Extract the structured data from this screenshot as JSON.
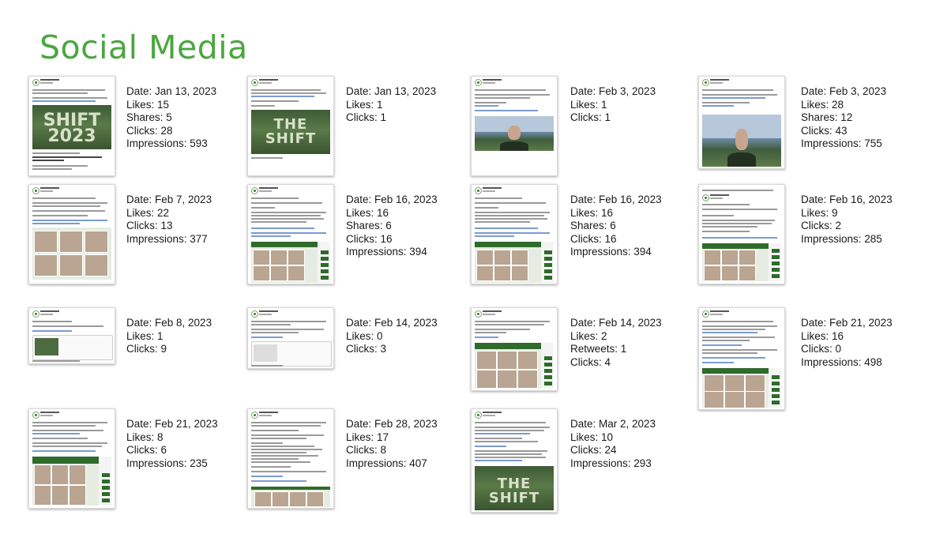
{
  "title": "Social Media",
  "posts": [
    {
      "date": "Date: Jan 13, 2023",
      "lines": [
        "Likes: 15",
        "Shares: 5",
        "Clicks: 28",
        "Impressions: 593"
      ],
      "media_text": "SHIFT 2023"
    },
    {
      "date": "Date: Jan 13, 2023",
      "lines": [
        "Likes: 1",
        "Clicks: 1"
      ],
      "media_text": "THE SHIFT"
    },
    {
      "date": "Date: Feb 3, 2023",
      "lines": [
        "Likes: 1",
        "Clicks: 1"
      ]
    },
    {
      "date": "Date: Feb 3, 2023",
      "lines": [
        "Likes: 28",
        "Shares: 12",
        "Clicks: 43",
        "Impressions: 755"
      ]
    },
    {
      "date": "Date: Feb 7, 2023",
      "lines": [
        "Likes: 22",
        "Clicks: 13",
        "Impressions: 377"
      ]
    },
    {
      "date": "Date: Feb 16, 2023",
      "lines": [
        "Likes: 16",
        "Shares: 6",
        "Clicks: 16",
        "Impressions: 394"
      ]
    },
    {
      "date": "Date: Feb 16, 2023",
      "lines": [
        "Likes: 16",
        "Shares: 6",
        "Clicks: 16",
        "Impressions: 394"
      ]
    },
    {
      "date": "Date: Feb 16, 2023",
      "lines": [
        "Likes: 9",
        "Clicks: 2",
        "Impressions: 285"
      ]
    },
    {
      "date": "Date: Feb 8, 2023",
      "lines": [
        "Likes: 1",
        "Clicks: 9"
      ]
    },
    {
      "date": "Date: Feb 14, 2023",
      "lines": [
        "Likes: 0",
        "Clicks: 3"
      ]
    },
    {
      "date": "Date: Feb 14, 2023",
      "lines": [
        "Likes: 2",
        "Retweets: 1",
        "Clicks: 4"
      ]
    },
    {
      "date": "Date: Feb 21, 2023",
      "lines": [
        "Likes: 16",
        "Clicks: 0",
        "Impressions: 498"
      ]
    },
    {
      "date": "Date: Feb 21, 2023",
      "lines": [
        "Likes: 8",
        "Clicks: 6",
        "Impressions: 235"
      ]
    },
    {
      "date": "Date: Feb 28, 2023",
      "lines": [
        "Likes: 17",
        "Clicks: 8",
        "Impressions: 407"
      ]
    },
    {
      "date": "Date: Mar 2, 2023",
      "lines": [
        "Likes: 10",
        "Clicks: 24",
        "Impressions: 293"
      ],
      "media_text": "THE SHIFT"
    }
  ]
}
